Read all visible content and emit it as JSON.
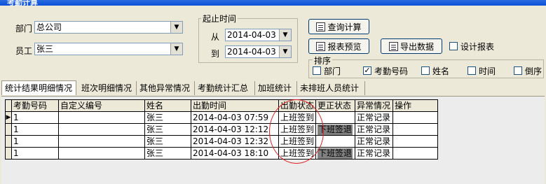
{
  "window": {
    "title": "考勤计算"
  },
  "filters": {
    "department_label": "部门",
    "department_value": "总公司",
    "employee_label": "员工",
    "employee_value": "张三"
  },
  "date_range": {
    "title": "起止时间",
    "from_label": "从",
    "from_value": "2014-04-03",
    "to_label": "到",
    "to_value": "2014-04-03"
  },
  "buttons": {
    "query": "查询计算",
    "report_preview": "报表预览",
    "export": "导出数据"
  },
  "design_report": {
    "label": "设计报表",
    "checked": false
  },
  "sort": {
    "title": "排序",
    "options": [
      {
        "label": "部门",
        "checked": false
      },
      {
        "label": "考勤号码",
        "checked": true
      },
      {
        "label": "姓名",
        "checked": false
      },
      {
        "label": "时间",
        "checked": false
      },
      {
        "label": "倒序",
        "checked": false
      }
    ]
  },
  "tabs": [
    "统计结果明细情况",
    "班次明细情况",
    "其他异常情况",
    "考勤统计汇总",
    "加班统计",
    "未排班人员统计"
  ],
  "table": {
    "columns": [
      "考勤号码",
      "自定义编号",
      "姓名",
      "出勤时间",
      "出勤状态",
      "更正状态",
      "异常情况",
      "操作"
    ],
    "rows": [
      [
        "1",
        "",
        "张三",
        "2014-04-03 07:59",
        "上班签到",
        "",
        "正常记录",
        ""
      ],
      [
        "1",
        "",
        "张三",
        "2014-04-03 12:12",
        "上班签到",
        "下班签退",
        "正常记录",
        ""
      ],
      [
        "1",
        "",
        "张三",
        "2014-04-03 12:32",
        "上班签到",
        "",
        "正常记录",
        ""
      ],
      [
        "1",
        "",
        "张三",
        "2014-04-03 18:10",
        "上班签到",
        "下班签退",
        "正常记录",
        ""
      ]
    ]
  }
}
